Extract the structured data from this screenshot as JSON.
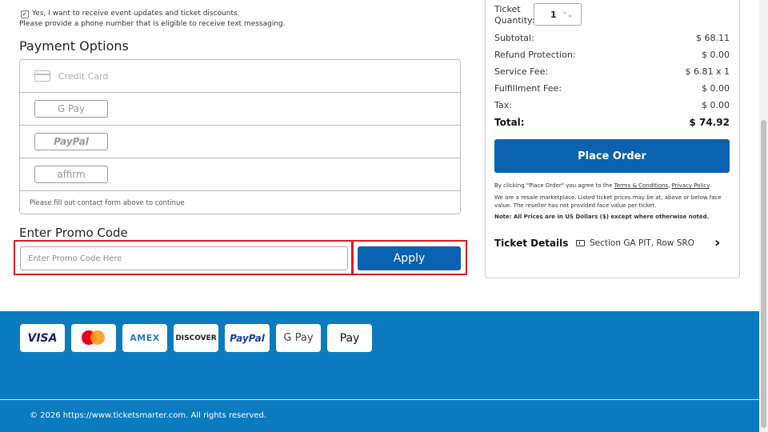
{
  "optin": {
    "checkbox_label": "Yes, I want to receive event updates and ticket discounts.",
    "note": "Please provide a phone number that is eligible to receive text messaging."
  },
  "payment": {
    "heading": "Payment Options",
    "credit_card": "Credit Card",
    "gpay": "G Pay",
    "paypal": "PayPal",
    "affirm": "affirm",
    "footer_note": "Please fill out contact form above to continue"
  },
  "promo": {
    "heading": "Enter Promo Code",
    "placeholder": "Enter Promo Code Here",
    "apply_label": "Apply"
  },
  "summary": {
    "qty_label_1": "Ticket",
    "qty_label_2": "Quantity:",
    "qty_value": "1",
    "lines": [
      {
        "label": "Subtotal:",
        "value": "$ 68.11"
      },
      {
        "label": "Refund Protection:",
        "value": "$ 0.00"
      },
      {
        "label": "Service Fee:",
        "value": "$ 6.81 x 1"
      },
      {
        "label": "Fulfillment Fee:",
        "value": "$ 0.00"
      },
      {
        "label": "Tax:",
        "value": "$ 0.00"
      }
    ],
    "total_label": "Total:",
    "total_value": "$ 74.92",
    "place_order": "Place Order",
    "agree_prefix": "By clicking \"Place Order\" you agree to the ",
    "terms": "Terms & Conditions",
    "sep": ", ",
    "privacy": "Privacy Policy",
    "agree_suffix": ".",
    "resale_note": "We are a resale marketplace. Listed ticket prices may be at, above or below face value. The reseller has not provided face value per ticket.",
    "currency_note": "Note: All Prices are in US Dollars ($) except where otherwise noted.",
    "ticket_details_title": "Ticket Details",
    "ticket_section": "Section GA PIT, Row SRO"
  },
  "footer": {
    "cards": [
      "VISA",
      "mastercard",
      "AMEX",
      "DISCOVER",
      "PayPal",
      "G Pay",
      "Pay"
    ],
    "copyright": "© 2026 https://www.ticketsmarter.com. All rights reserved."
  },
  "colors": {
    "primary": "#0a62b0",
    "footer_bg": "#0b7bbf",
    "highlight": "#e0191e"
  }
}
